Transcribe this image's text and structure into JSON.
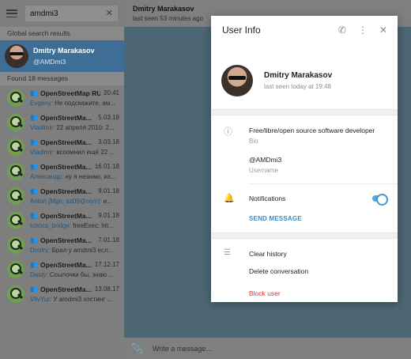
{
  "search": {
    "value": "amdmi3",
    "clear_glyph": "✕"
  },
  "sections": {
    "global": "Global search results",
    "found": "Found 18 messages"
  },
  "global_result": {
    "name": "Dmitry Marakasov",
    "handle": "@AMDmi3"
  },
  "messages": [
    {
      "chat": "OpenStreetMap RU",
      "date": "20:41",
      "sender": "Evgeny:",
      "text": "Не подскажите, ам..."
    },
    {
      "chat": "OpenStreetMa...",
      "date": "5.03.18",
      "sender": "Vladimir:",
      "text": "22 апреля 2010: 2..."
    },
    {
      "chat": "OpenStreetMa...",
      "date": "3.03.18",
      "sender": "Vladimir:",
      "text": "вспомнил ещё 22 ..."
    },
    {
      "chat": "OpenStreetMa...",
      "date": "16.01.18",
      "sender": "Александр:",
      "text": "ну я незнаю, их..."
    },
    {
      "chat": "OpenStreetMa...",
      "date": "9.01.18",
      "sender": "Anton [Mgn, az09@osm]:",
      "text": "и..."
    },
    {
      "chat": "OpenStreetMa...",
      "date": "9.01.18",
      "sender": "tchncs_bridge:",
      "text": "freeExec: htt..."
    },
    {
      "chat": "OpenStreetMa...",
      "date": "7.01.18",
      "sender": "Dmitry:",
      "text": "Брал у amdmi3 есл..."
    },
    {
      "chat": "OpenStreetMa...",
      "date": "17.12.17",
      "sender": "Dasty:",
      "text": "Ссылочки бы, знаю ..."
    },
    {
      "chat": "OpenStreetMa...",
      "date": "13.08.17",
      "sender": "VlivYur:",
      "text": "У amdmi3 хостинг ..."
    }
  ],
  "chat": {
    "title": "Dmitry Marakasov",
    "status": "last seen 53 minutes ago",
    "composer_placeholder": "Write a message..."
  },
  "modal": {
    "title": "User Info",
    "name": "Dmitry Marakasov",
    "status": "last seen today at 19:48",
    "bio_value": "Free/libre/open source software developer",
    "bio_label": "Bio",
    "username_value": "@AMDmi3",
    "username_label": "Username",
    "notifications_label": "Notifications",
    "notifications_on": true,
    "send_message": "SEND MESSAGE",
    "clear_history": "Clear history",
    "delete_conversation": "Delete conversation",
    "block_user": "Block user"
  },
  "icons": {
    "menu": "menu-icon",
    "phone": "phone-icon",
    "more": "more-vertical-icon",
    "close": "close-icon",
    "info": "info-icon",
    "bell": "bell-icon",
    "list": "list-icon",
    "attach": "paperclip-icon",
    "group": "group-icon"
  },
  "colors": {
    "accent": "#3a8cc8",
    "danger": "#cc3b3b",
    "selected": "#3e6e96"
  }
}
